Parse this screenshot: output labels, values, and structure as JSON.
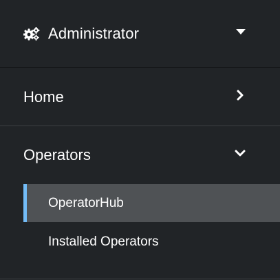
{
  "perspective": {
    "label": "Administrator",
    "icon": "cogs-icon"
  },
  "nav": {
    "home": {
      "label": "Home",
      "icon": "chevron-right-icon"
    },
    "operators": {
      "label": "Operators",
      "icon": "chevron-down-icon",
      "items": [
        {
          "label": "OperatorHub",
          "active": true
        },
        {
          "label": "Installed Operators",
          "active": false
        }
      ]
    }
  },
  "colors": {
    "background": "#212427",
    "active_bg": "#4f5255",
    "active_accent": "#73bcf7",
    "text": "#ffffff"
  }
}
